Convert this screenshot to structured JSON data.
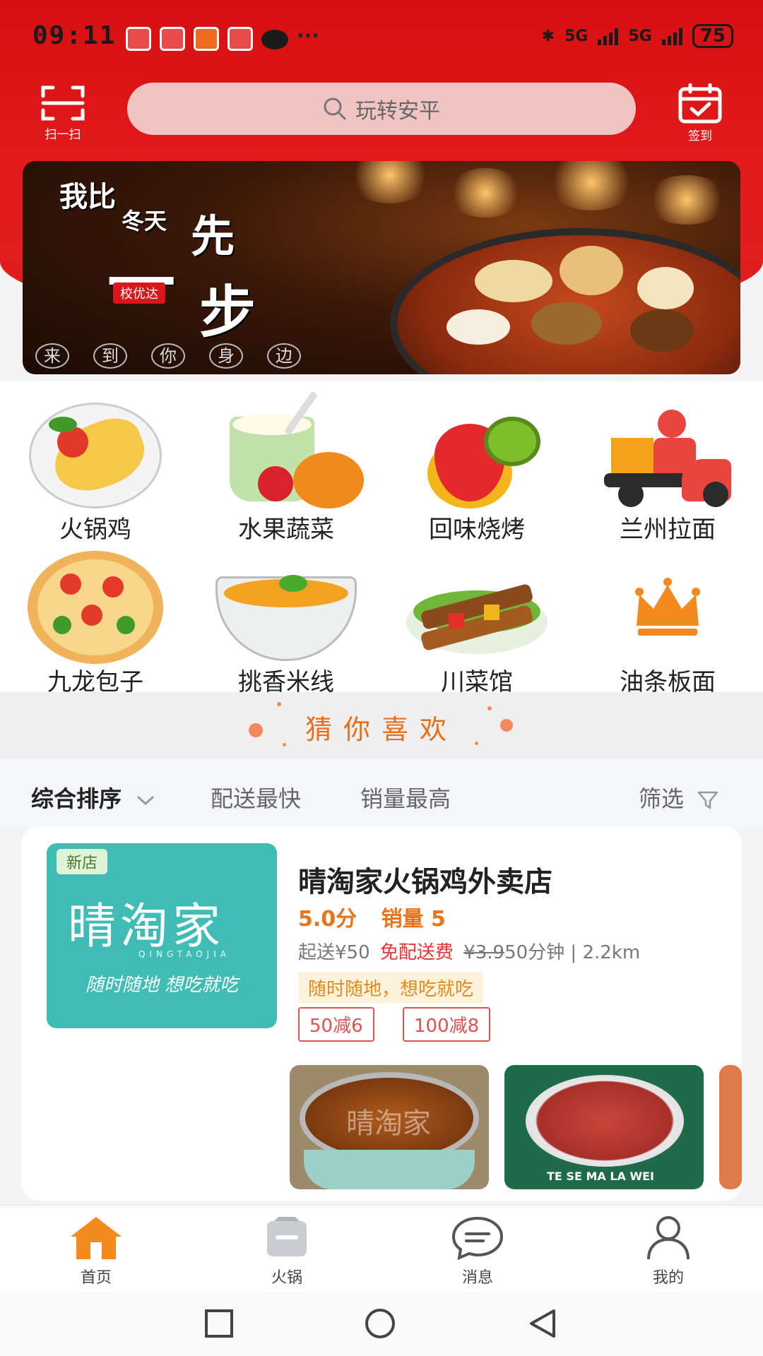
{
  "status_bar": {
    "time": "09:11",
    "network_1": "5G",
    "network_2": "5G",
    "battery": "75",
    "more": "···"
  },
  "header": {
    "scan_label": "扫一扫",
    "checkin_label": "签到",
    "search_placeholder": "玩转安平"
  },
  "banner": {
    "line1": "我比",
    "line2": "冬天",
    "line3": "先",
    "line4": "一",
    "line5": "步",
    "badge": "校优达",
    "bottom_chars": [
      "来",
      "到",
      "你",
      "身",
      "边"
    ]
  },
  "categories": [
    {
      "label": "火锅鸡",
      "icon": "omelette-plate-icon"
    },
    {
      "label": "水果蔬菜",
      "icon": "yogurt-fruit-icon"
    },
    {
      "label": "回味烧烤",
      "icon": "strawberry-kiwi-icon"
    },
    {
      "label": "兰州拉面",
      "icon": "delivery-scooter-icon"
    },
    {
      "label": "九龙包子",
      "icon": "pizza-icon"
    },
    {
      "label": "挑香米线",
      "icon": "soup-bowl-icon"
    },
    {
      "label": "川菜馆",
      "icon": "kebab-platter-icon"
    },
    {
      "label": "油条板面",
      "icon": "crown-icon"
    }
  ],
  "guess_you_like": "猜你喜欢",
  "sort": {
    "overall": "综合排序",
    "fastest": "配送最快",
    "top_sales": "销量最高",
    "filter": "筛选"
  },
  "shop": {
    "tag": "新店",
    "logo_name": "晴淘家",
    "logo_pinyin": "QINGTAOJIA",
    "logo_slogan": "随时随地 想吃就吃",
    "name": "晴淘家火锅鸡外卖店",
    "rating": "5.0分",
    "sales": "销量 5",
    "min_order": "起送¥50",
    "free_delivery": "免配送费",
    "orig_fee": "¥3.9",
    "time_distance": "50分钟 | 2.2km",
    "slogan": "随时随地，想吃就吃",
    "coupons": [
      "50减6",
      "100减8"
    ],
    "dish_watermark": "晴淘家",
    "dish2_caption": "TE SE MA LA WEI"
  },
  "tabbar": {
    "home": "首页",
    "hotpot": "火锅",
    "messages": "消息",
    "mine": "我的"
  },
  "colors": {
    "brand_red": "#e31b1b",
    "accent_orange": "#f28a1e",
    "coupon_red": "#e35050"
  }
}
